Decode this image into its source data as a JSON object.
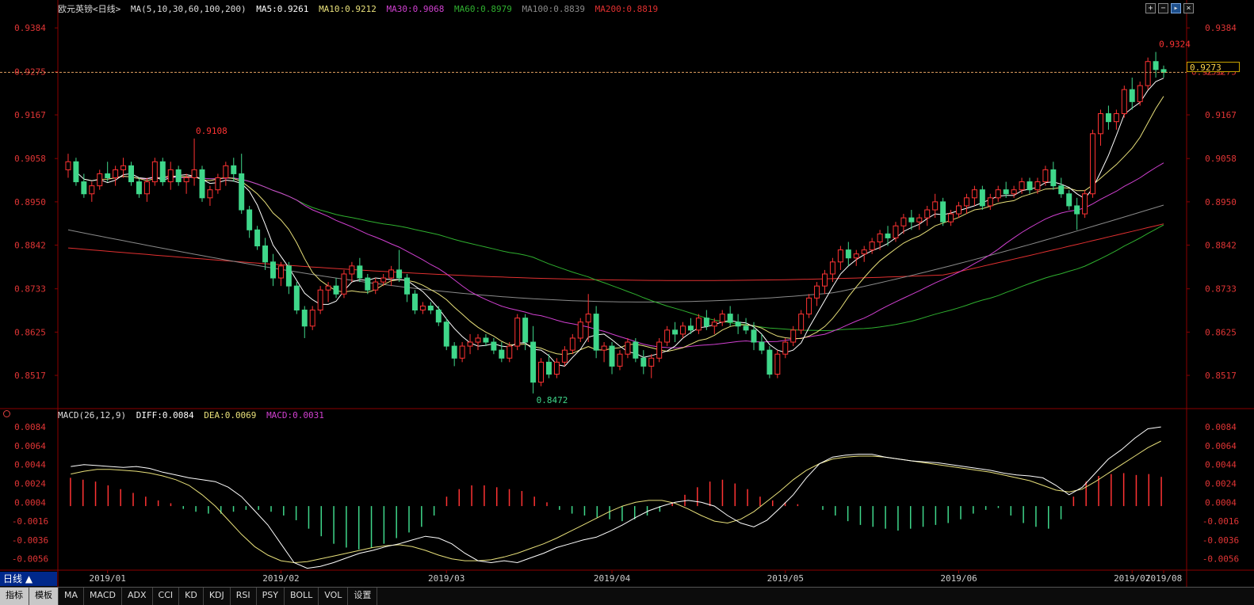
{
  "instrument": {
    "name": "欧元英镑",
    "period_tag": "<日线>"
  },
  "ma_legend": {
    "ma_params": "MA(5,10,30,60,100,200)",
    "ma5": "MA5:0.9261",
    "ma10": "MA10:0.9212",
    "ma30": "MA30:0.9068",
    "ma60": "MA60:0.8979",
    "ma100": "MA100:0.8839",
    "ma200": "MA200:0.8819"
  },
  "macd_legend": {
    "params": "MACD(26,12,9)",
    "diff": "DIFF:0.0084",
    "dea": "DEA:0.0069",
    "macd": "MACD:0.0031"
  },
  "colors": {
    "up": "#ff3333",
    "down": "#3fd78a",
    "ma5": "#ffffff",
    "ma10": "#e8e07a",
    "ma30": "#d040d0",
    "ma60": "#2fb02f",
    "ma100": "#8a8a8a",
    "ma200": "#e03030",
    "price_axis": "#e03535",
    "macd_axis": "#e03535",
    "grid": "#8b0000"
  },
  "chart_data": [
    {
      "type": "candlestick",
      "title": "欧元英镑<日线>",
      "ylim": [
        0.844,
        0.942
      ],
      "y_ticks": [
        "0.9384",
        "0.9275",
        "0.9167",
        "0.9058",
        "0.8950",
        "0.8842",
        "0.8733",
        "0.8625",
        "0.8517"
      ],
      "x_labels": [
        "2019/01",
        "2019/02",
        "2019/03",
        "2019/04",
        "2019/05",
        "2019/06",
        "2019/07",
        "2019/08"
      ],
      "annotations": {
        "high_label": "0.9108",
        "low_label": "0.8472",
        "last_high_label": "0.9324",
        "current_price": "0.9273",
        "right_ref": "0.9275"
      },
      "last_price": 0.9273,
      "candles_ohlc": [
        [
          0.903,
          0.907,
          0.901,
          0.905
        ],
        [
          0.905,
          0.906,
          0.899,
          0.9
        ],
        [
          0.9,
          0.902,
          0.896,
          0.897
        ],
        [
          0.897,
          0.9,
          0.895,
          0.899
        ],
        [
          0.899,
          0.903,
          0.898,
          0.902
        ],
        [
          0.902,
          0.905,
          0.9,
          0.901
        ],
        [
          0.901,
          0.904,
          0.899,
          0.903
        ],
        [
          0.903,
          0.906,
          0.901,
          0.904
        ],
        [
          0.904,
          0.905,
          0.899,
          0.9
        ],
        [
          0.9,
          0.901,
          0.896,
          0.897
        ],
        [
          0.897,
          0.901,
          0.895,
          0.9
        ],
        [
          0.9,
          0.906,
          0.899,
          0.905
        ],
        [
          0.905,
          0.906,
          0.899,
          0.9
        ],
        [
          0.9,
          0.905,
          0.898,
          0.903
        ],
        [
          0.903,
          0.904,
          0.899,
          0.9
        ],
        [
          0.9,
          0.902,
          0.897,
          0.901
        ],
        [
          0.901,
          0.9108,
          0.899,
          0.903
        ],
        [
          0.903,
          0.904,
          0.895,
          0.896
        ],
        [
          0.896,
          0.899,
          0.894,
          0.898
        ],
        [
          0.898,
          0.902,
          0.897,
          0.901
        ],
        [
          0.901,
          0.905,
          0.899,
          0.904
        ],
        [
          0.904,
          0.906,
          0.9,
          0.902
        ],
        [
          0.902,
          0.907,
          0.892,
          0.893
        ],
        [
          0.893,
          0.894,
          0.886,
          0.888
        ],
        [
          0.888,
          0.889,
          0.883,
          0.884
        ],
        [
          0.884,
          0.886,
          0.878,
          0.88
        ],
        [
          0.88,
          0.882,
          0.874,
          0.876
        ],
        [
          0.876,
          0.88,
          0.874,
          0.879
        ],
        [
          0.879,
          0.88,
          0.872,
          0.874
        ],
        [
          0.874,
          0.875,
          0.867,
          0.868
        ],
        [
          0.868,
          0.869,
          0.861,
          0.864
        ],
        [
          0.864,
          0.869,
          0.863,
          0.868
        ],
        [
          0.868,
          0.874,
          0.867,
          0.873
        ],
        [
          0.873,
          0.875,
          0.87,
          0.874
        ],
        [
          0.874,
          0.876,
          0.871,
          0.872
        ],
        [
          0.872,
          0.878,
          0.871,
          0.877
        ],
        [
          0.877,
          0.88,
          0.875,
          0.879
        ],
        [
          0.879,
          0.881,
          0.875,
          0.876
        ],
        [
          0.876,
          0.877,
          0.872,
          0.873
        ],
        [
          0.873,
          0.876,
          0.872,
          0.875
        ],
        [
          0.875,
          0.877,
          0.874,
          0.876
        ],
        [
          0.876,
          0.879,
          0.874,
          0.878
        ],
        [
          0.878,
          0.883,
          0.875,
          0.876
        ],
        [
          0.876,
          0.877,
          0.87,
          0.872
        ],
        [
          0.872,
          0.873,
          0.867,
          0.868
        ],
        [
          0.868,
          0.87,
          0.867,
          0.869
        ],
        [
          0.869,
          0.87,
          0.867,
          0.868
        ],
        [
          0.868,
          0.869,
          0.864,
          0.865
        ],
        [
          0.865,
          0.866,
          0.858,
          0.859
        ],
        [
          0.859,
          0.86,
          0.854,
          0.856
        ],
        [
          0.856,
          0.86,
          0.855,
          0.859
        ],
        [
          0.859,
          0.862,
          0.857,
          0.86
        ],
        [
          0.86,
          0.862,
          0.858,
          0.861
        ],
        [
          0.861,
          0.862,
          0.859,
          0.86
        ],
        [
          0.86,
          0.861,
          0.857,
          0.858
        ],
        [
          0.858,
          0.86,
          0.855,
          0.856
        ],
        [
          0.856,
          0.86,
          0.855,
          0.859
        ],
        [
          0.859,
          0.867,
          0.858,
          0.866
        ],
        [
          0.866,
          0.867,
          0.858,
          0.86
        ],
        [
          0.86,
          0.864,
          0.8472,
          0.85
        ],
        [
          0.85,
          0.856,
          0.849,
          0.855
        ],
        [
          0.855,
          0.857,
          0.851,
          0.852
        ],
        [
          0.852,
          0.856,
          0.851,
          0.855
        ],
        [
          0.855,
          0.859,
          0.854,
          0.858
        ],
        [
          0.858,
          0.862,
          0.857,
          0.861
        ],
        [
          0.861,
          0.866,
          0.86,
          0.865
        ],
        [
          0.865,
          0.872,
          0.86,
          0.867
        ],
        [
          0.867,
          0.869,
          0.856,
          0.858
        ],
        [
          0.858,
          0.86,
          0.855,
          0.859
        ],
        [
          0.859,
          0.86,
          0.852,
          0.854
        ],
        [
          0.854,
          0.858,
          0.853,
          0.857
        ],
        [
          0.857,
          0.861,
          0.856,
          0.86
        ],
        [
          0.86,
          0.861,
          0.855,
          0.856
        ],
        [
          0.856,
          0.858,
          0.852,
          0.854
        ],
        [
          0.854,
          0.857,
          0.851,
          0.856
        ],
        [
          0.856,
          0.861,
          0.855,
          0.86
        ],
        [
          0.86,
          0.864,
          0.859,
          0.863
        ],
        [
          0.863,
          0.865,
          0.86,
          0.862
        ],
        [
          0.862,
          0.865,
          0.861,
          0.864
        ],
        [
          0.864,
          0.866,
          0.862,
          0.863
        ],
        [
          0.863,
          0.867,
          0.862,
          0.866
        ],
        [
          0.866,
          0.868,
          0.863,
          0.864
        ],
        [
          0.864,
          0.866,
          0.862,
          0.865
        ],
        [
          0.865,
          0.868,
          0.864,
          0.867
        ],
        [
          0.867,
          0.869,
          0.864,
          0.865
        ],
        [
          0.865,
          0.867,
          0.862,
          0.864
        ],
        [
          0.864,
          0.866,
          0.862,
          0.863
        ],
        [
          0.863,
          0.865,
          0.858,
          0.86
        ],
        [
          0.86,
          0.862,
          0.857,
          0.858
        ],
        [
          0.858,
          0.859,
          0.851,
          0.852
        ],
        [
          0.852,
          0.858,
          0.851,
          0.857
        ],
        [
          0.857,
          0.861,
          0.856,
          0.86
        ],
        [
          0.86,
          0.864,
          0.859,
          0.863
        ],
        [
          0.863,
          0.868,
          0.862,
          0.867
        ],
        [
          0.867,
          0.872,
          0.866,
          0.871
        ],
        [
          0.871,
          0.875,
          0.869,
          0.874
        ],
        [
          0.874,
          0.878,
          0.872,
          0.877
        ],
        [
          0.877,
          0.881,
          0.875,
          0.88
        ],
        [
          0.88,
          0.884,
          0.878,
          0.883
        ],
        [
          0.883,
          0.885,
          0.879,
          0.881
        ],
        [
          0.881,
          0.883,
          0.879,
          0.882
        ],
        [
          0.882,
          0.884,
          0.88,
          0.883
        ],
        [
          0.883,
          0.886,
          0.882,
          0.885
        ],
        [
          0.885,
          0.888,
          0.883,
          0.887
        ],
        [
          0.887,
          0.889,
          0.884,
          0.886
        ],
        [
          0.886,
          0.89,
          0.885,
          0.889
        ],
        [
          0.889,
          0.892,
          0.887,
          0.891
        ],
        [
          0.891,
          0.893,
          0.888,
          0.89
        ],
        [
          0.89,
          0.892,
          0.888,
          0.891
        ],
        [
          0.891,
          0.894,
          0.889,
          0.893
        ],
        [
          0.893,
          0.897,
          0.891,
          0.895
        ],
        [
          0.895,
          0.896,
          0.889,
          0.89
        ],
        [
          0.89,
          0.893,
          0.889,
          0.892
        ],
        [
          0.892,
          0.895,
          0.891,
          0.894
        ],
        [
          0.894,
          0.897,
          0.892,
          0.896
        ],
        [
          0.896,
          0.899,
          0.894,
          0.898
        ],
        [
          0.898,
          0.899,
          0.893,
          0.894
        ],
        [
          0.894,
          0.897,
          0.893,
          0.896
        ],
        [
          0.896,
          0.899,
          0.895,
          0.898
        ],
        [
          0.898,
          0.9,
          0.896,
          0.897
        ],
        [
          0.897,
          0.899,
          0.896,
          0.898
        ],
        [
          0.898,
          0.901,
          0.897,
          0.9
        ],
        [
          0.9,
          0.901,
          0.897,
          0.898
        ],
        [
          0.898,
          0.901,
          0.897,
          0.9
        ],
        [
          0.9,
          0.904,
          0.899,
          0.903
        ],
        [
          0.903,
          0.905,
          0.898,
          0.899
        ],
        [
          0.899,
          0.901,
          0.896,
          0.897
        ],
        [
          0.897,
          0.898,
          0.893,
          0.894
        ],
        [
          0.894,
          0.896,
          0.888,
          0.892
        ],
        [
          0.892,
          0.898,
          0.891,
          0.897
        ],
        [
          0.897,
          0.913,
          0.896,
          0.912
        ],
        [
          0.912,
          0.918,
          0.909,
          0.917
        ],
        [
          0.917,
          0.919,
          0.913,
          0.915
        ],
        [
          0.915,
          0.918,
          0.913,
          0.917
        ],
        [
          0.917,
          0.924,
          0.916,
          0.923
        ],
        [
          0.923,
          0.926,
          0.918,
          0.92
        ],
        [
          0.92,
          0.925,
          0.919,
          0.924
        ],
        [
          0.924,
          0.931,
          0.923,
          0.93
        ],
        [
          0.93,
          0.9324,
          0.926,
          0.928
        ],
        [
          0.928,
          0.929,
          0.926,
          0.9273
        ]
      ]
    },
    {
      "type": "macd",
      "title": "MACD(26,12,9)",
      "ylim": [
        -0.0068,
        0.009
      ],
      "y_ticks": [
        "0.0084",
        "0.0064",
        "0.0044",
        "0.0024",
        "0.0004",
        "-0.0016",
        "-0.0036",
        "-0.0056"
      ],
      "diff": [
        0.0042,
        0.0044,
        0.0043,
        0.0042,
        0.0041,
        0.0042,
        0.004,
        0.0036,
        0.0033,
        0.003,
        0.0028,
        0.0026,
        0.002,
        0.001,
        -0.0005,
        -0.002,
        -0.004,
        -0.006,
        -0.0066,
        -0.0064,
        -0.006,
        -0.0055,
        -0.005,
        -0.0047,
        -0.0043,
        -0.004,
        -0.0036,
        -0.0032,
        -0.0034,
        -0.004,
        -0.005,
        -0.0058,
        -0.006,
        -0.0058,
        -0.006,
        -0.0055,
        -0.005,
        -0.0044,
        -0.004,
        -0.0036,
        -0.0033,
        -0.0027,
        -0.002,
        -0.0012,
        -0.0005,
        0.0,
        0.0004,
        0.0006,
        0.0004,
        0.0,
        -0.001,
        -0.0018,
        -0.0022,
        -0.0015,
        -0.0002,
        0.0012,
        0.003,
        0.0045,
        0.0052,
        0.0054,
        0.0055,
        0.0055,
        0.0052,
        0.005,
        0.0048,
        0.0047,
        0.0046,
        0.0044,
        0.0042,
        0.004,
        0.0038,
        0.0035,
        0.0033,
        0.0032,
        0.003,
        0.0022,
        0.0012,
        0.002,
        0.0035,
        0.005,
        0.006,
        0.0072,
        0.0082,
        0.0084
      ],
      "dea": [
        0.0034,
        0.0037,
        0.0039,
        0.0039,
        0.0038,
        0.0037,
        0.0035,
        0.0032,
        0.0028,
        0.0022,
        0.0012,
        0.0,
        -0.0015,
        -0.003,
        -0.0043,
        -0.0052,
        -0.0058,
        -0.006,
        -0.0059,
        -0.0056,
        -0.0053,
        -0.005,
        -0.0047,
        -0.0044,
        -0.0042,
        -0.0041,
        -0.0043,
        -0.0047,
        -0.0052,
        -0.0056,
        -0.0058,
        -0.0058,
        -0.0057,
        -0.0054,
        -0.005,
        -0.0045,
        -0.004,
        -0.0034,
        -0.0027,
        -0.002,
        -0.0013,
        -0.0006,
        0.0,
        0.0004,
        0.0006,
        0.0006,
        0.0003,
        -0.0003,
        -0.001,
        -0.0016,
        -0.0018,
        -0.0014,
        -0.0006,
        0.0005,
        0.0016,
        0.0028,
        0.0038,
        0.0045,
        0.005,
        0.0052,
        0.0053,
        0.0053,
        0.0052,
        0.005,
        0.0048,
        0.0046,
        0.0044,
        0.0042,
        0.004,
        0.0038,
        0.0036,
        0.0033,
        0.003,
        0.0027,
        0.0022,
        0.0017,
        0.0015,
        0.0018,
        0.0026,
        0.0035,
        0.0044,
        0.0053,
        0.0062,
        0.0069
      ],
      "hist": [
        0.003,
        0.0028,
        0.0026,
        0.0022,
        0.0018,
        0.0014,
        0.001,
        0.0006,
        0.0003,
        -0.0003,
        -0.0006,
        -0.0008,
        -0.0008,
        -0.0006,
        -0.0004,
        -0.0004,
        -0.0006,
        -0.001,
        -0.0015,
        -0.0024,
        -0.0032,
        -0.004,
        -0.0044,
        -0.0046,
        -0.0044,
        -0.004,
        -0.0034,
        -0.0028,
        -0.0022,
        -0.001,
        0.001,
        0.0018,
        0.0022,
        0.0022,
        0.002,
        0.0018,
        0.0016,
        0.001,
        0.0004,
        -0.0004,
        -0.0008,
        -0.001,
        -0.0012,
        -0.0014,
        -0.0016,
        -0.0014,
        -0.001,
        -0.0006,
        0.0004,
        0.0012,
        0.002,
        0.0026,
        0.0028,
        0.0024,
        0.0018,
        0.001,
        0.0006,
        0.0004,
        0.0002,
        0.0,
        -0.0004,
        -0.001,
        -0.0016,
        -0.002,
        -0.0022,
        -0.0024,
        -0.0026,
        -0.0024,
        -0.0022,
        -0.002,
        -0.0018,
        -0.0014,
        -0.0008,
        -0.0004,
        -0.0002,
        -0.001,
        -0.0018,
        -0.0022,
        -0.0024,
        -0.0014,
        0.001,
        0.0026,
        0.0032,
        0.0034,
        0.0035,
        0.0033,
        0.0034,
        0.0031
      ]
    }
  ],
  "period_button": {
    "label": "日线",
    "arrow": "▲"
  },
  "tabs": [
    "指标",
    "模板",
    "MA",
    "MACD",
    "ADX",
    "CCI",
    "KD",
    "KDJ",
    "RSI",
    "PSY",
    "BOLL",
    "VOL",
    "设置"
  ],
  "window_buttons": [
    "plus-icon",
    "minus-icon",
    "expand-icon",
    "close-icon"
  ]
}
